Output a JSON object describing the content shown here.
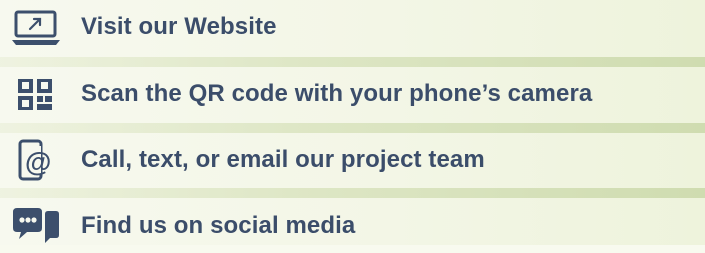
{
  "colors": {
    "text": "#3b4d6a",
    "icon": "#3c4f6c",
    "background": "#f7f9ef",
    "divider": "#dde6c4"
  },
  "items": [
    {
      "icon": "laptop-link-icon",
      "label": "Visit our Website"
    },
    {
      "icon": "qr-code-icon",
      "label": "Scan the QR code with your phone’s camera"
    },
    {
      "icon": "phone-email-icon",
      "label": "Call, text, or email our project team"
    },
    {
      "icon": "social-chat-icon",
      "label": "Find us on social media"
    }
  ]
}
